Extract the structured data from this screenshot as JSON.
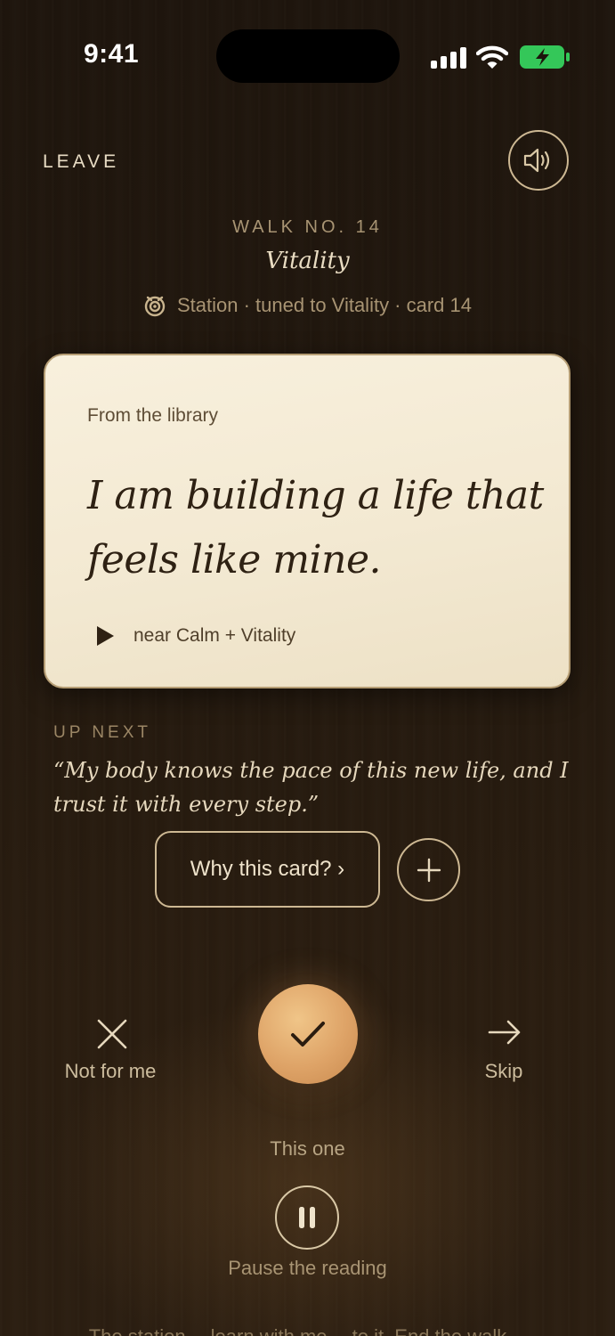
{
  "status_bar": {
    "time": "9:41"
  },
  "header": {
    "leave_label": "LEAVE"
  },
  "walk": {
    "number_label": "WALK NO. 14",
    "theme": "Vitality",
    "station_text": "Station · tuned to Vitality · card 14"
  },
  "card": {
    "source": "From the library",
    "quote": "I am building a life that feels like mine.",
    "near_text": "near Calm + Vitality"
  },
  "up_next": {
    "label": "UP NEXT",
    "quote": "“My body knows the pace of this new life, and I trust it with every step.”"
  },
  "buttons": {
    "why_label": "Why this card? ›",
    "not_for_me_label": "Not for me",
    "skip_label": "Skip",
    "this_one_label": "This one",
    "pause_label": "Pause the reading"
  },
  "footer": {
    "text": "The station… learn with me… to it. End the walk…"
  },
  "colors": {
    "accent": "#dea367",
    "background": "#1d140c",
    "card": "#f5ecd7",
    "outline": "#cdb893"
  },
  "icons": {
    "sound": "speaker-icon",
    "station": "station-icon",
    "play": "play-icon",
    "add": "plus-icon",
    "not_for_me": "close-icon",
    "accept": "checkmark-icon",
    "skip": "arrow-right-icon",
    "pause": "pause-icon"
  }
}
